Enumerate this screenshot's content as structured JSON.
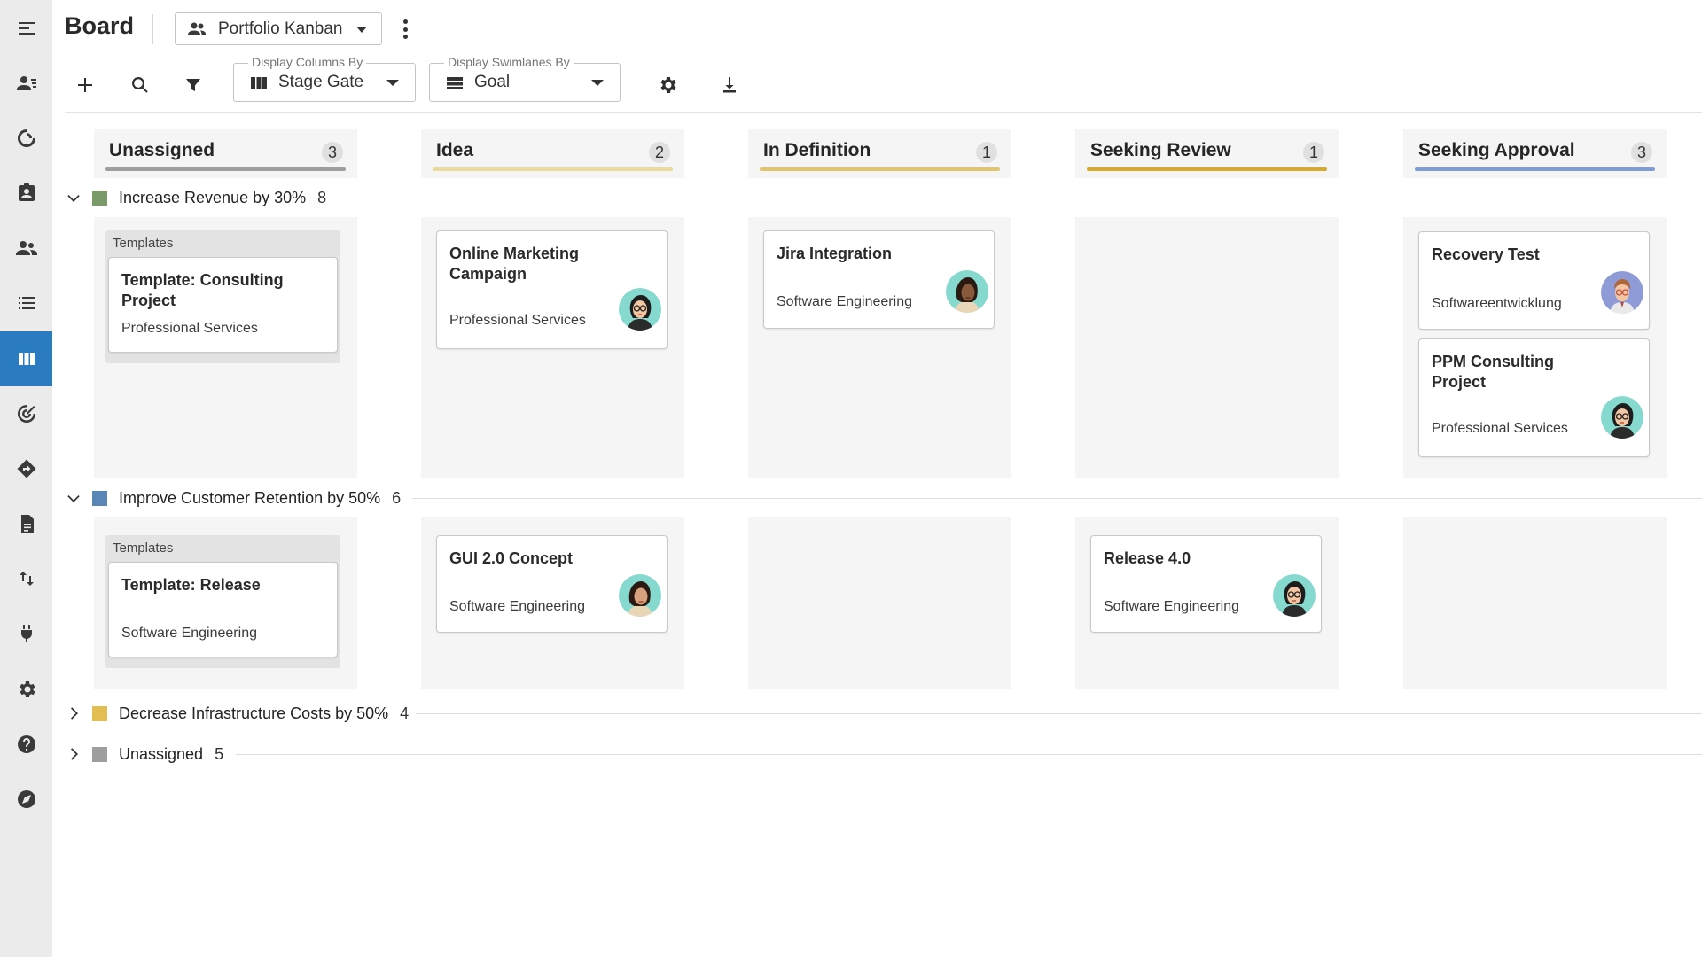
{
  "page": {
    "title": "Board"
  },
  "view_selector": {
    "label": "Portfolio Kanban",
    "icon": "people-icon"
  },
  "toolbar": {
    "add_icon": "plus-icon",
    "search_icon": "search-icon",
    "filter_icon": "filter-icon",
    "columns_field": {
      "legend": "Display Columns By",
      "value": "Stage Gate",
      "icon": "columns-icon"
    },
    "swimlanes_field": {
      "legend": "Display Swimlanes By",
      "value": "Goal",
      "icon": "rows-icon"
    },
    "settings_icon": "gear-icon",
    "download_icon": "download-icon"
  },
  "sidebar": {
    "items": [
      {
        "name": "menu-icon"
      },
      {
        "name": "user-list-icon"
      },
      {
        "name": "refresh-circle-icon"
      },
      {
        "name": "badge-icon"
      },
      {
        "name": "people-icon"
      },
      {
        "name": "list-icon"
      },
      {
        "name": "board-icon",
        "active": true
      },
      {
        "name": "target-icon"
      },
      {
        "name": "roadmap-icon"
      },
      {
        "name": "document-icon"
      },
      {
        "name": "transfer-icon"
      },
      {
        "name": "plug-icon"
      },
      {
        "name": "gear-icon"
      },
      {
        "name": "help-icon"
      },
      {
        "name": "compass-icon"
      }
    ]
  },
  "columns": [
    {
      "title": "Unassigned",
      "count": "3",
      "color": "#9e9e9e"
    },
    {
      "title": "Idea",
      "count": "2",
      "color": "#eadb9a"
    },
    {
      "title": "In Definition",
      "count": "1",
      "color": "#e2c56a"
    },
    {
      "title": "Seeking Review",
      "count": "1",
      "color": "#d9a92a"
    },
    {
      "title": "Seeking Approval",
      "count": "3",
      "color": "#7f9ed8"
    }
  ],
  "swimlanes": [
    {
      "name": "Increase Revenue by 30%",
      "count": "8",
      "color": "#7a9a6a",
      "expanded": true,
      "template_label": "Templates",
      "template_card": {
        "title": "Template: Consulting Project",
        "subtitle": "Professional Services"
      },
      "cards": {
        "idea": {
          "title": "Online Marketing Campaign",
          "subtitle": "Professional Services"
        },
        "in_definition": {
          "title": "Jira Integration",
          "subtitle": "Software Engineering"
        },
        "seeking_approval": [
          {
            "title": "Recovery Test",
            "subtitle": "Softwareentwicklung"
          },
          {
            "title": "PPM Consulting Project",
            "subtitle": "Professional Services"
          }
        ]
      }
    },
    {
      "name": "Improve Customer Retention by 50%",
      "count": "6",
      "color": "#5a86b6",
      "expanded": true,
      "template_label": "Templates",
      "template_card": {
        "title": "Template: Release",
        "subtitle": "Software Engineering"
      },
      "cards": {
        "idea": {
          "title": "GUI 2.0 Concept",
          "subtitle": "Software Engineering"
        },
        "seeking_review": {
          "title": "Release 4.0",
          "subtitle": "Software Engineering"
        }
      }
    },
    {
      "name": "Decrease Infrastructure Costs by 50%",
      "count": "4",
      "color": "#e2bd4f",
      "expanded": false
    },
    {
      "name": "Unassigned",
      "count": "5",
      "color": "#9e9e9e",
      "expanded": false
    }
  ]
}
